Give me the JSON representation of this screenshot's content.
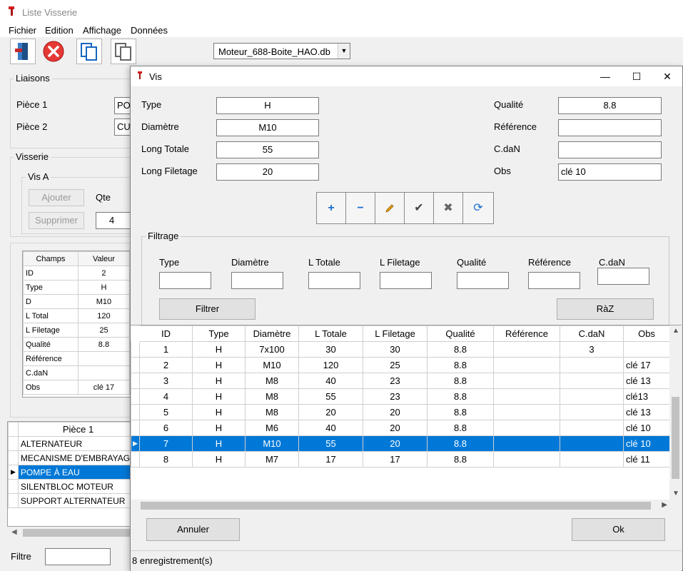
{
  "app": {
    "title": "Liste Visserie",
    "menu": [
      "Fichier",
      "Edition",
      "Affichage",
      "Données"
    ],
    "db_file": "Moteur_688-Boite_HAO.db"
  },
  "liaisons": {
    "label": "Liaisons",
    "piece1_label": "Pièce 1",
    "piece1_value": "PO",
    "piece2_label": "Pièce 2",
    "piece2_value": "CU"
  },
  "visserie": {
    "label": "Visserie",
    "vis_a_label": "Vis A",
    "ajouter": "Ajouter",
    "supprimer": "Supprimer",
    "qte_label": "Qte",
    "qte_value": "4"
  },
  "champs_table": {
    "headers": [
      "Champs",
      "Valeur"
    ],
    "rows": [
      [
        "ID",
        "2"
      ],
      [
        "Type",
        "H"
      ],
      [
        "D",
        "M10"
      ],
      [
        "L Total",
        "120"
      ],
      [
        "L Filetage",
        "25"
      ],
      [
        "Qualité",
        "8.8"
      ],
      [
        "Référence",
        ""
      ],
      [
        "C.daN",
        ""
      ],
      [
        "Obs",
        "clé 17"
      ]
    ]
  },
  "piece_list": {
    "header": "Pièce 1",
    "items": [
      "ALTERNATEUR",
      "MECANISME D'EMBRAYAGE",
      "POMPE À EAU",
      "SILENTBLOC MOTEUR",
      "SUPPORT ALTERNATEUR"
    ],
    "selected_index": 2
  },
  "filtre_label": "Filtre",
  "dialog": {
    "title": "Vis",
    "fields_left": [
      {
        "label": "Type",
        "value": "H"
      },
      {
        "label": "Diamètre",
        "value": "M10"
      },
      {
        "label": "Long Totale",
        "value": "55"
      },
      {
        "label": "Long Filetage",
        "value": "20"
      }
    ],
    "fields_right": [
      {
        "label": "Qualité",
        "value": "8.8"
      },
      {
        "label": "Référence",
        "value": ""
      },
      {
        "label": "C.daN",
        "value": ""
      },
      {
        "label": "Obs",
        "value": "clé 10"
      }
    ],
    "actions": [
      "plus-icon",
      "minus-icon",
      "pencil-icon",
      "check-icon",
      "cross-icon",
      "refresh-icon"
    ],
    "filtrage": {
      "label": "Filtrage",
      "fields": [
        "Type",
        "Diamètre",
        "L Totale",
        "L Filetage",
        "Qualité",
        "Référence",
        "C.daN"
      ],
      "filtrer": "Filtrer",
      "raz": "RàZ"
    },
    "grid": {
      "headers": [
        "ID",
        "Type",
        "Diamètre",
        "L Totale",
        "L Filetage",
        "Qualité",
        "Référence",
        "C.daN",
        "Obs"
      ],
      "rows": [
        [
          "1",
          "H",
          "7x100",
          "30",
          "30",
          "8.8",
          "",
          "3",
          ""
        ],
        [
          "2",
          "H",
          "M10",
          "120",
          "25",
          "8.8",
          "",
          "",
          "clé 17"
        ],
        [
          "3",
          "H",
          "M8",
          "40",
          "23",
          "8.8",
          "",
          "",
          "clé 13"
        ],
        [
          "4",
          "H",
          "M8",
          "55",
          "23",
          "8.8",
          "",
          "",
          "clé13"
        ],
        [
          "5",
          "H",
          "M8",
          "20",
          "20",
          "8.8",
          "",
          "",
          "clé 13"
        ],
        [
          "6",
          "H",
          "M6",
          "40",
          "20",
          "8.8",
          "",
          "",
          "clé 10"
        ],
        [
          "7",
          "H",
          "M10",
          "55",
          "20",
          "8.8",
          "",
          "",
          "clé 10"
        ],
        [
          "8",
          "H",
          "M7",
          "17",
          "17",
          "8.8",
          "",
          "",
          "clé 11"
        ]
      ],
      "selected_index": 6
    },
    "annuler": "Annuler",
    "ok": "Ok",
    "status": "8 enregistrement(s)"
  },
  "colors": {
    "selection": "#0078d7",
    "accent_blue": "#1a6fb5"
  }
}
